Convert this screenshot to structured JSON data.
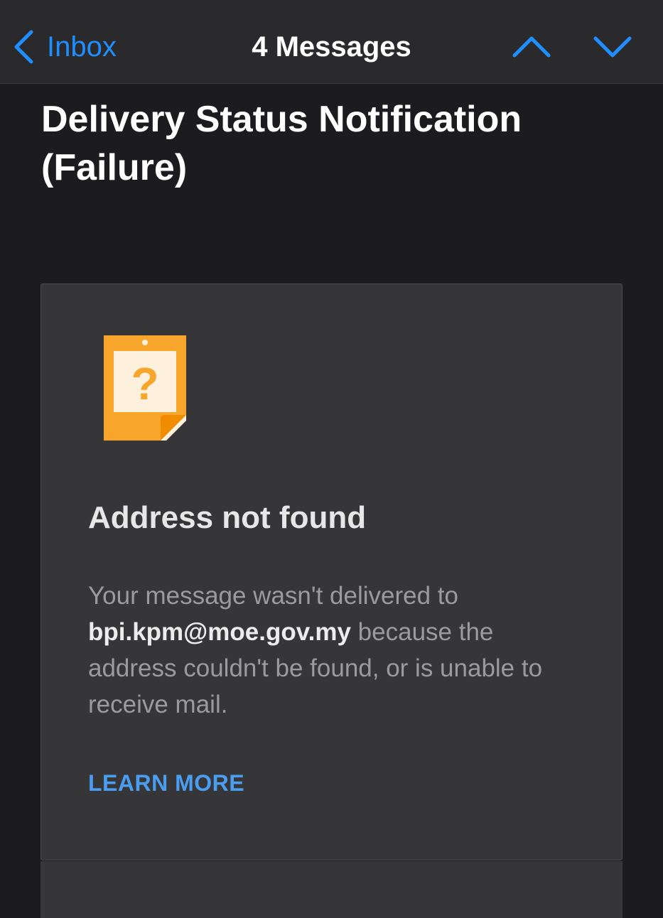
{
  "navbar": {
    "back_label": "Inbox",
    "title": "4 Messages",
    "accent_color": "#1f8fff"
  },
  "email": {
    "subject": "Delivery Status Notification (Failure)"
  },
  "card": {
    "icon": "question-note-icon",
    "heading": "Address not found",
    "body_prefix": "Your message wasn't delivered to",
    "recipient": "bpi.kpm@moe.gov.my",
    "body_suffix": "because the address couldn't be found, or is unable to receive mail.",
    "link_label": "LEARN MORE",
    "icon_color": "#f7a52b",
    "link_color": "#4a9df0"
  }
}
